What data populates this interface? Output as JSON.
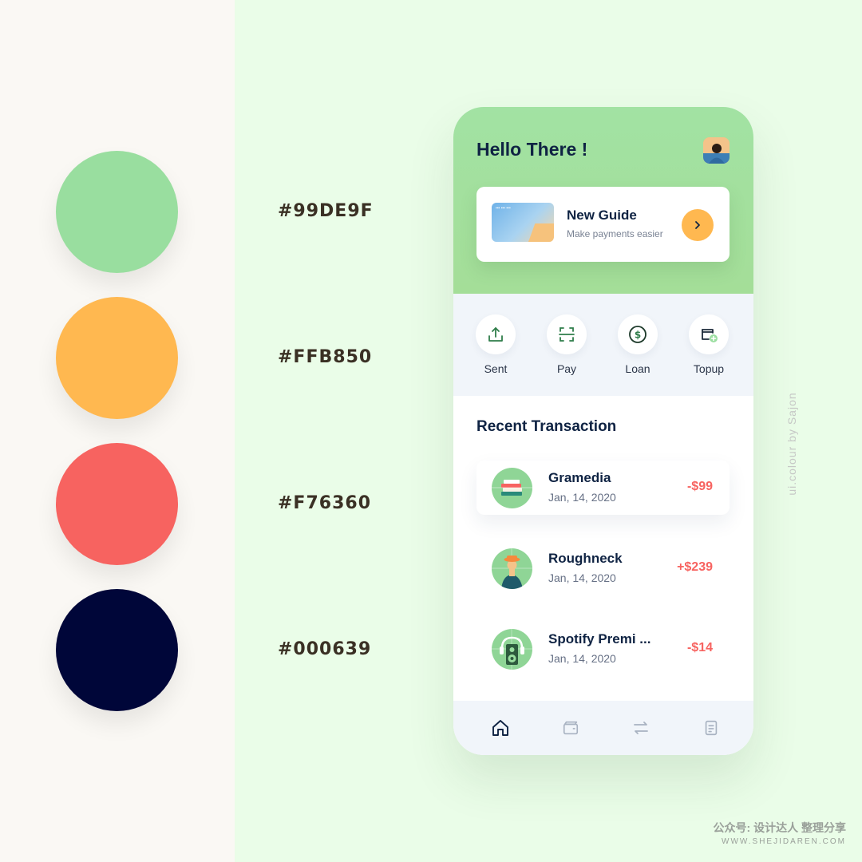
{
  "palette": {
    "colors": [
      {
        "hex": "#99DE9F",
        "label": "#99DE9F"
      },
      {
        "hex": "#FFB850",
        "label": "#FFB850"
      },
      {
        "hex": "#F76360",
        "label": "#F76360"
      },
      {
        "hex": "#000639",
        "label": "#000639"
      }
    ]
  },
  "credit": "ui.colour by Sajon",
  "watermark": {
    "line1": "公众号: 设计达人 整理分享",
    "line2": "WWW.SHEJIDAREN.COM"
  },
  "app": {
    "greeting": "Hello There !",
    "avatar_icon": "user-avatar",
    "guide": {
      "title": "New Guide",
      "subtitle": "Make payments easier",
      "arrow_icon": "chevron-right-icon"
    },
    "actions": [
      {
        "label": "Sent",
        "icon": "upload-icon"
      },
      {
        "label": "Pay",
        "icon": "scan-icon"
      },
      {
        "label": "Loan",
        "icon": "dollar-coin-icon"
      },
      {
        "label": "Topup",
        "icon": "wallet-plus-icon"
      }
    ],
    "recent_title": "Recent Transaction",
    "transactions": [
      {
        "name": "Gramedia",
        "date": "Jan, 14, 2020",
        "amount": "-$99",
        "icon": "books-icon"
      },
      {
        "name": "Roughneck",
        "date": "Jan, 14, 2020",
        "amount": "+$239",
        "icon": "person-hat-icon"
      },
      {
        "name": "Spotify Premi ...",
        "date": "Jan, 14, 2020",
        "amount": "-$14",
        "icon": "headphones-speaker-icon"
      }
    ],
    "nav": [
      {
        "icon": "home-icon",
        "active": true
      },
      {
        "icon": "wallet-icon",
        "active": false
      },
      {
        "icon": "transfer-icon",
        "active": false
      },
      {
        "icon": "document-icon",
        "active": false
      }
    ],
    "colors": {
      "primary_green": "#99DE9F",
      "accent_orange": "#FFB850",
      "negative_red": "#F76360",
      "navy": "#000639"
    }
  }
}
